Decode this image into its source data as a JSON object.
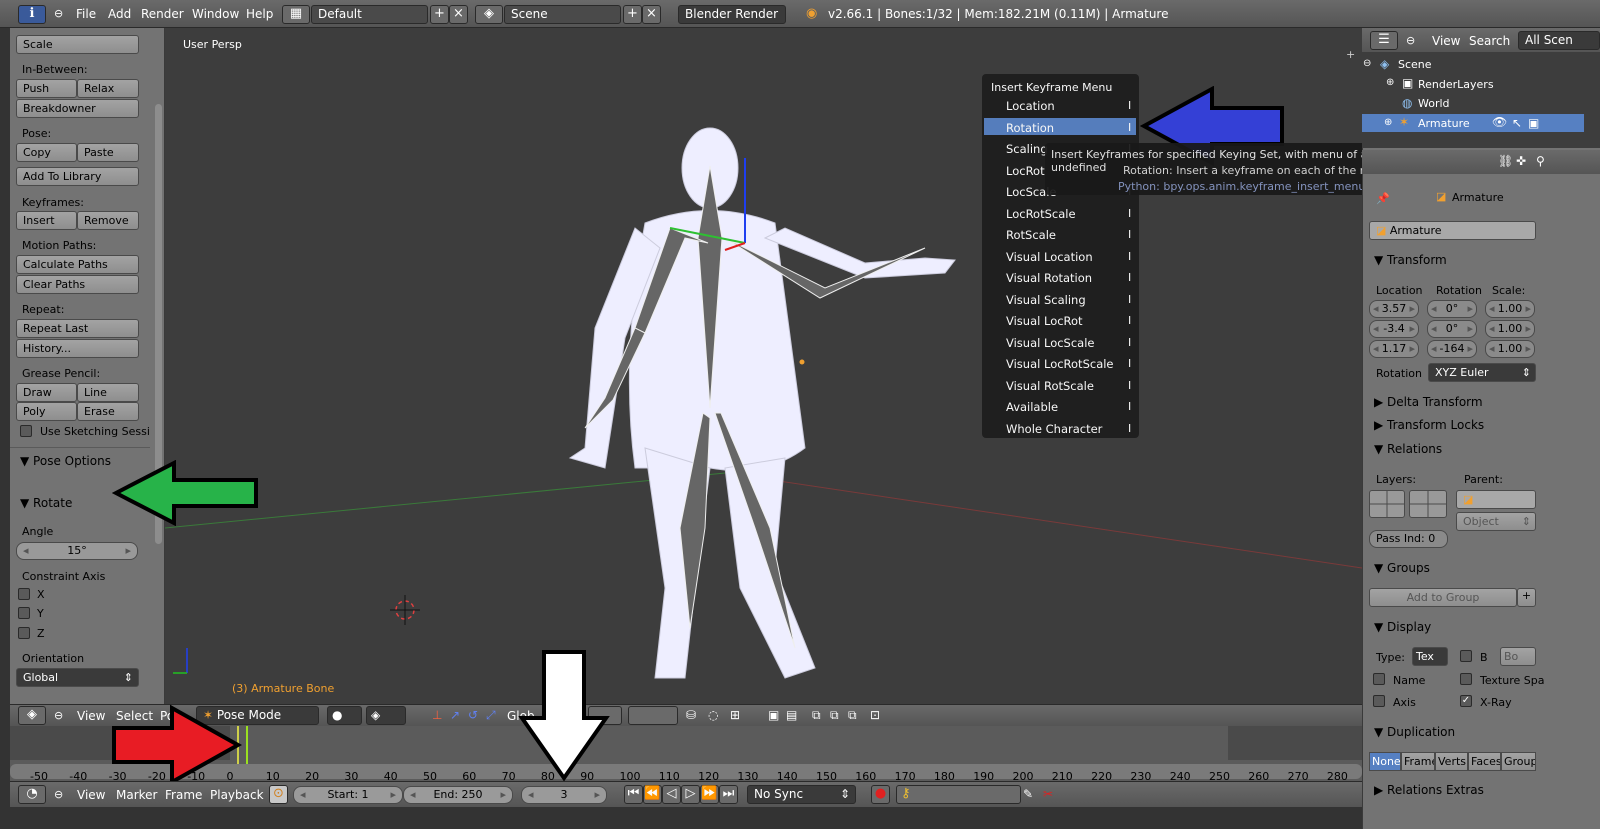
{
  "topbar": {
    "menus": [
      "File",
      "Add",
      "Render",
      "Window",
      "Help"
    ],
    "layout": "Default",
    "scene": "Scene",
    "engine": "Blender Render",
    "status": "v2.66.1 | Bones:1/32  | Mem:182.21M (0.11M) | Armature"
  },
  "toolshelf": {
    "top_btn": "Scale",
    "in_between_label": "In-Between:",
    "push": "Push",
    "relax": "Relax",
    "breakdowner": "Breakdowner",
    "pose_label": "Pose:",
    "copy": "Copy",
    "paste": "Paste",
    "add_library": "Add To Library",
    "keyframes_label": "Keyframes:",
    "insert": "Insert",
    "remove": "Remove",
    "motion_label": "Motion Paths:",
    "calc_paths": "Calculate Paths",
    "clear_paths": "Clear Paths",
    "repeat_label": "Repeat:",
    "repeat_last": "Repeat Last",
    "history": "History...",
    "grease_label": "Grease Pencil:",
    "draw": "Draw",
    "line": "Line",
    "poly": "Poly",
    "erase": "Erase",
    "sketching": "Use Sketching Sessi",
    "pose_options": "Pose Options",
    "rotate_header": "Rotate",
    "angle_label": "Angle",
    "angle_value": "15°",
    "constraint_label": "Constraint Axis",
    "x": "X",
    "y": "Y",
    "z": "Z",
    "orientation_label": "Orientation",
    "orientation_value": "Global"
  },
  "viewport": {
    "view_name": "User Persp",
    "object_label": "(3) Armature Bone"
  },
  "keyframe_menu": {
    "title": "Insert Keyframe Menu",
    "items": [
      "Location",
      "Rotation",
      "Scaling",
      "LocRot",
      "LocScale",
      "LocRotScale",
      "RotScale",
      "Visual Location",
      "Visual Rotation",
      "Visual Scaling",
      "Visual LocRot",
      "Visual LocScale",
      "Visual LocRotScale",
      "Visual RotScale",
      "Available",
      "Whole Character"
    ],
    "shortcut": "I",
    "selected": "Rotation"
  },
  "tooltip": {
    "line1": "Insert Keyframes for specified Keying Set, with menu of available Keying Sets if undefined",
    "line2": "Rotation: Insert a keyframe on each of the rotation channels",
    "line3": "Python: bpy.ops.anim.keyframe_insert_menu(type='Rotation')"
  },
  "outliner": {
    "view": "View",
    "search": "Search",
    "all_scenes": "All Scen",
    "items": [
      "Scene",
      "RenderLayers",
      "World",
      "Armature"
    ]
  },
  "properties": {
    "object_name_top": "Armature",
    "object_name": "Armature",
    "transform": "Transform",
    "location_label": "Location",
    "rotation_label": "Rotation",
    "scale_label": "Scale:",
    "location": [
      "3.57",
      "-3.4",
      "1.17"
    ],
    "rotation": [
      "0°",
      "0°",
      "-164"
    ],
    "scale": [
      "1.00",
      "1.00",
      "1.00"
    ],
    "rotation_mode_label": "Rotation",
    "rotation_mode": "XYZ Euler",
    "delta_transform": "Delta Transform",
    "transform_locks": "Transform Locks",
    "relations": "Relations",
    "layers_label": "Layers:",
    "parent_label": "Parent:",
    "parent_type": "Object",
    "pass_index": "Pass Ind: 0",
    "groups": "Groups",
    "add_to_group": "Add to Group",
    "display": "Display",
    "type_label": "Type:",
    "type_value": "Tex",
    "b": "B",
    "bo": "Bo",
    "name": "Name",
    "texture_space": "Texture Spa",
    "axis": "Axis",
    "xray": "X-Ray",
    "duplication": "Duplication",
    "dup_options": [
      "None",
      "Frame",
      "Verts",
      "Faces",
      "Group"
    ],
    "relations_extras": "Relations Extras"
  },
  "view_header": {
    "view": "View",
    "select": "Select",
    "pose": "Po",
    "mode": "Pose Mode",
    "global": "Glob"
  },
  "timeline": {
    "ticks": [
      "-50",
      "-40",
      "-30",
      "-20",
      "-10",
      "0",
      "10",
      "20",
      "30",
      "40",
      "50",
      "60",
      "70",
      "80",
      "90",
      "100",
      "110",
      "120",
      "130",
      "140",
      "150",
      "160",
      "170",
      "180",
      "190",
      "200",
      "210",
      "220",
      "230",
      "240",
      "250",
      "260",
      "270",
      "280"
    ],
    "current_frame": 3
  },
  "timeline_header": {
    "view": "View",
    "marker": "Marker",
    "frame": "Frame",
    "playback": "Playback",
    "start": "Start: 1",
    "end": "End: 250",
    "current": "3",
    "sync": "No Sync"
  }
}
